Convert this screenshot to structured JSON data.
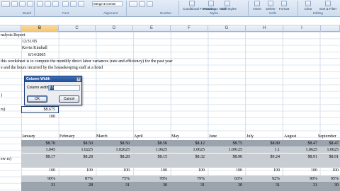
{
  "ribbon": {
    "buttons": [
      {
        "key": "clipboard",
        "label": ""
      },
      {
        "key": "font_size",
        "label": "A"
      },
      {
        "key": "align",
        "label": ""
      },
      {
        "key": "merge",
        "label": "Merge & Center"
      },
      {
        "key": "number",
        "label": "$ % ,"
      },
      {
        "key": "cond_format",
        "label": "Conditional Formatting"
      },
      {
        "key": "format_table",
        "label": "Format as Table"
      },
      {
        "key": "cell_styles",
        "label": "Cell Styles"
      },
      {
        "key": "insert",
        "label": "Insert"
      },
      {
        "key": "delete",
        "label": "Delete"
      },
      {
        "key": "format",
        "label": "Format"
      },
      {
        "key": "clear",
        "label": "Clear"
      },
      {
        "key": "sort",
        "label": "Sort & Filter"
      }
    ],
    "groups": [
      "Board",
      "Font",
      "Alignment",
      "Number",
      "Styles",
      "Cells",
      "Editing"
    ]
  },
  "columns": [
    "B",
    "C",
    "D",
    "E",
    "F",
    "G",
    "H",
    "I"
  ],
  "selected_column": "B",
  "sheet": {
    "title_cell": "nalysis Report",
    "date_cell": "12/31/05",
    "author": "Kevin Kimball",
    "date2": "8/14/2005",
    "desc1": "this worksheet is to compute the monthly direct labor variances (rate and efficiency) for the past year",
    "desc2": "e and the hours incurred by the housekeeping staff at a hotel",
    "label_paren": ")",
    "label_rm": "rs)",
    "cell_rate": "$8.675",
    "cell_100": "100",
    "label_ne": "ew rs)"
  },
  "months": [
    "January",
    "February",
    "March",
    "April",
    "May",
    "June",
    "July",
    "August",
    "September"
  ],
  "rows": {
    "rates": [
      "$8.70",
      "$8.50",
      "$8.50",
      "$8.50",
      "$8.12",
      "$8.75",
      "$8.80",
      "$8.47",
      "$8.47"
    ],
    "factors": [
      "1.045",
      "1.0225",
      "1.02625",
      "1.0625",
      "1.0625",
      "1.09125",
      "1.1",
      "1.0625",
      "1.0625"
    ],
    "actual": [
      "$8.17",
      "$8.28",
      "$8.28",
      "$8.15",
      "$8.32",
      "$8.90",
      "$9.24",
      "$8.91",
      "$8.91"
    ],
    "hundreds": [
      "100",
      "100",
      "100",
      "100",
      "100",
      "100",
      "100",
      "100",
      "100"
    ],
    "pct": [
      "90%",
      "87%",
      "75%",
      "78%",
      "79%",
      "83%",
      "92%",
      "90%",
      "95%"
    ],
    "last": [
      "31",
      "28",
      "31",
      "30",
      "31",
      "30",
      "31",
      "31",
      "30"
    ]
  },
  "dialog": {
    "title": "Column Width",
    "close": "✕",
    "label": "Column width:",
    "value": "15",
    "ok": "OK",
    "cancel": "Cancel"
  }
}
